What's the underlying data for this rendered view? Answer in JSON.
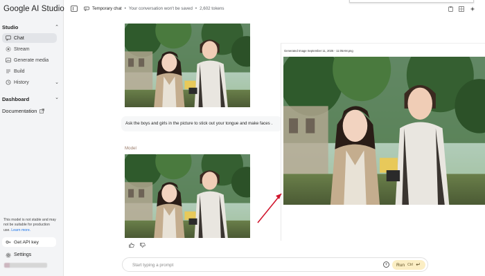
{
  "app": {
    "title": "Google AI Studio"
  },
  "sidebar": {
    "studio_label": "Studio",
    "items": [
      {
        "label": "Chat",
        "icon": "chat-icon"
      },
      {
        "label": "Stream",
        "icon": "stream-icon"
      },
      {
        "label": "Generate media",
        "icon": "media-icon"
      },
      {
        "label": "Build",
        "icon": "build-icon"
      },
      {
        "label": "History",
        "icon": "history-icon"
      }
    ],
    "dashboard_label": "Dashboard",
    "documentation_label": "Documentation",
    "notice": "This model is not stable and may not be suitable for production use.",
    "notice_link": "Learn more.",
    "api_key_label": "Get API key",
    "settings_label": "Settings"
  },
  "topbar": {
    "chat_title": "Temporary chat",
    "chat_subtitle": "Your conversation won't be saved",
    "tokens": "2,602 tokens"
  },
  "chat": {
    "user_prompt": "Ask the boys and girls in the picture to stick out your tongue and make faces .",
    "model_label": "Model"
  },
  "composer": {
    "placeholder": "Start typing a prompt",
    "run_label": "Run",
    "run_shortcut": "Ctrl"
  },
  "overlay": {
    "image_name": "Generated Image September 11, 2025 - 11:05AM.png"
  },
  "colors": {
    "accent": "#fbeec4",
    "link": "#1a73e8",
    "arrow": "#d0152d",
    "sidebar_bg": "#f3f4f6"
  }
}
